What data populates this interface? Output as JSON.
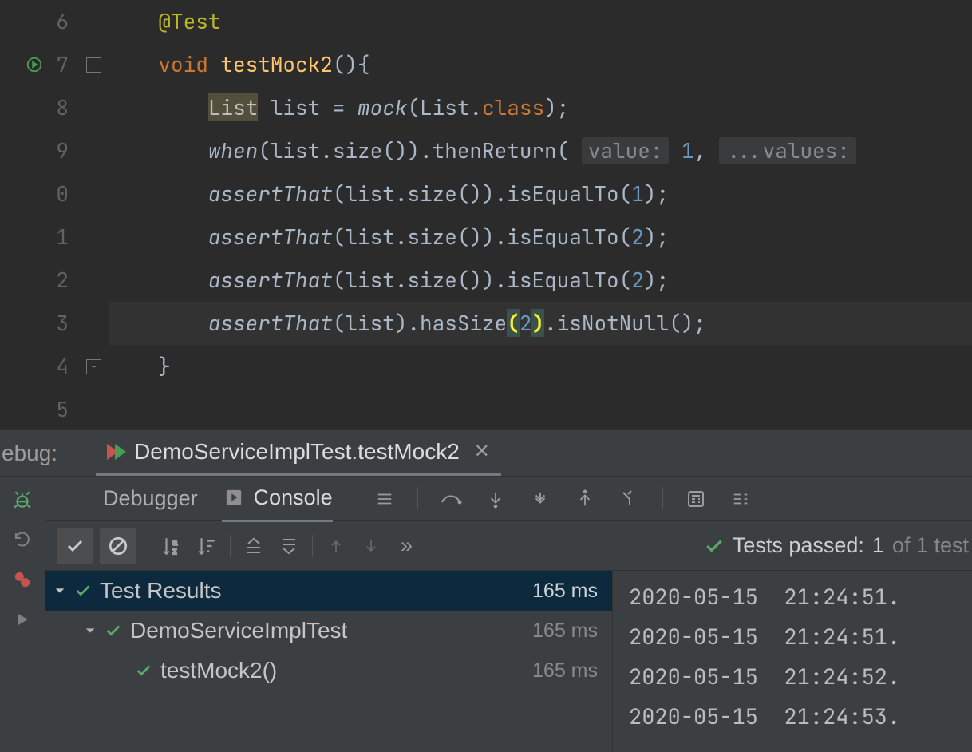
{
  "editor": {
    "gutter_start": 6,
    "lines": [
      {
        "n": "6",
        "tokens": [
          {
            "t": "    ",
            "c": ""
          },
          {
            "t": "@Test",
            "c": "an"
          }
        ]
      },
      {
        "n": "7",
        "run": true,
        "fold": "open",
        "tokens": [
          {
            "t": "    ",
            "c": ""
          },
          {
            "t": "void ",
            "c": "kw"
          },
          {
            "t": "testMock2",
            "c": "mn"
          },
          {
            "t": "(){ ",
            "c": ""
          }
        ]
      },
      {
        "n": "8",
        "tokens": [
          {
            "t": "        ",
            "c": ""
          },
          {
            "t": "List",
            "c": "warn"
          },
          {
            "t": " list = ",
            "c": ""
          },
          {
            "t": "mock",
            "c": "it"
          },
          {
            "t": "(List.",
            "c": ""
          },
          {
            "t": "class",
            "c": "kw"
          },
          {
            "t": ");",
            "c": ""
          }
        ]
      },
      {
        "n": "9",
        "tokens": [
          {
            "t": "        ",
            "c": ""
          },
          {
            "t": "when",
            "c": "it"
          },
          {
            "t": "(list.size()).thenReturn( ",
            "c": ""
          },
          {
            "t": "value:",
            "c": "hint"
          },
          {
            "t": " ",
            "c": ""
          },
          {
            "t": "1",
            "c": "nm"
          },
          {
            "t": ", ",
            "c": ""
          },
          {
            "t": "...values:",
            "c": "hint"
          },
          {
            "t": " ",
            "c": ""
          }
        ]
      },
      {
        "n": "0",
        "tokens": [
          {
            "t": "        ",
            "c": ""
          },
          {
            "t": "assertThat",
            "c": "it"
          },
          {
            "t": "(list.size()).isEqualTo(",
            "c": ""
          },
          {
            "t": "1",
            "c": "nm"
          },
          {
            "t": ");",
            "c": ""
          }
        ]
      },
      {
        "n": "1",
        "tokens": [
          {
            "t": "        ",
            "c": ""
          },
          {
            "t": "assertThat",
            "c": "it"
          },
          {
            "t": "(list.size()).isEqualTo(",
            "c": ""
          },
          {
            "t": "2",
            "c": "nm"
          },
          {
            "t": ");",
            "c": ""
          }
        ]
      },
      {
        "n": "2",
        "tokens": [
          {
            "t": "        ",
            "c": ""
          },
          {
            "t": "assertThat",
            "c": "it"
          },
          {
            "t": "(list.size()).isEqualTo(",
            "c": ""
          },
          {
            "t": "2",
            "c": "nm"
          },
          {
            "t": ");",
            "c": ""
          }
        ]
      },
      {
        "n": "3",
        "hl": true,
        "tokens": [
          {
            "t": "        ",
            "c": ""
          },
          {
            "t": "assertThat",
            "c": "it"
          },
          {
            "t": "(list).hasSize",
            "c": ""
          },
          {
            "t": "(",
            "c": "paren-hl"
          },
          {
            "t": "2",
            "c": "nm"
          },
          {
            "t": ")",
            "c": "paren-hl"
          },
          {
            "t": ".isNotNull();",
            "c": ""
          }
        ]
      },
      {
        "n": "4",
        "fold": "close",
        "tokens": [
          {
            "t": "    }",
            "c": ""
          }
        ]
      },
      {
        "n": "5",
        "tokens": [
          {
            "t": "",
            "c": ""
          }
        ]
      }
    ]
  },
  "debug": {
    "label": "ebug:",
    "tab_title": "DemoServiceImplTest.testMock2"
  },
  "subtabs": {
    "debugger": "Debugger",
    "console": "Console"
  },
  "status": {
    "passed_label": "Tests passed:",
    "passed_count": "1",
    "of_label": "of 1 test"
  },
  "tree": {
    "root": {
      "label": "Test Results",
      "time": "165 ms"
    },
    "suite": {
      "label": "DemoServiceImplTest",
      "time": "165 ms"
    },
    "test": {
      "label": "testMock2()",
      "time": "165 ms"
    }
  },
  "console_lines": [
    "2020-05-15  21:24:51.",
    "2020-05-15  21:24:51.",
    "2020-05-15  21:24:52.",
    "2020-05-15  21:24:53."
  ]
}
